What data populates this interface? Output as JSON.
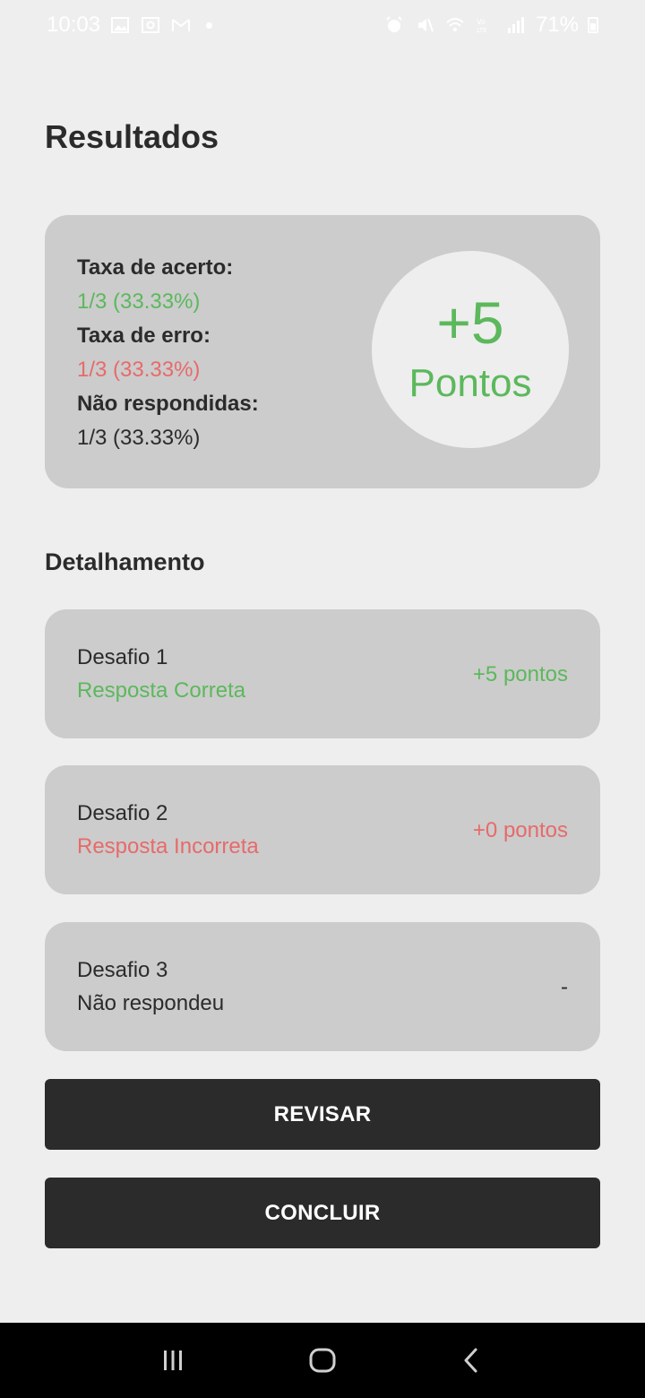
{
  "status_bar": {
    "time": "10:03",
    "battery": "71%",
    "left_icons": [
      "image-icon",
      "photo-frame-icon",
      "gmail-icon",
      "dot-icon"
    ],
    "right_icons": [
      "alarm-icon",
      "mute-icon",
      "wifi-icon",
      "volte-icon",
      "signal-icon",
      "battery-icon"
    ]
  },
  "page": {
    "title": "Resultados"
  },
  "summary": {
    "correct_label": "Taxa de acerto:",
    "correct_value": "1/3 (33.33%)",
    "wrong_label": "Taxa de erro:",
    "wrong_value": "1/3 (33.33%)",
    "unanswered_label": "Não respondidas:",
    "unanswered_value": "1/3 (33.33%)",
    "score_value": "+5",
    "score_unit": "Pontos"
  },
  "details": {
    "title": "Detalhamento",
    "items": [
      {
        "name": "Desafio 1",
        "status": "Resposta Correta",
        "points": "+5 pontos"
      },
      {
        "name": "Desafio 2",
        "status": "Resposta Incorreta",
        "points": "+0 pontos"
      },
      {
        "name": "Desafio 3",
        "status": "Não respondeu",
        "points": "-"
      }
    ]
  },
  "actions": {
    "review_label": "REVISAR",
    "finish_label": "CONCLUIR"
  },
  "colors": {
    "background": "#eeeeee",
    "card": "#cccccc",
    "correct": "#5cb85c",
    "incorrect": "#e86a6a",
    "button": "#2b2b2b"
  },
  "nav": {
    "icons": [
      "recent-apps-icon",
      "home-icon",
      "back-icon"
    ]
  }
}
